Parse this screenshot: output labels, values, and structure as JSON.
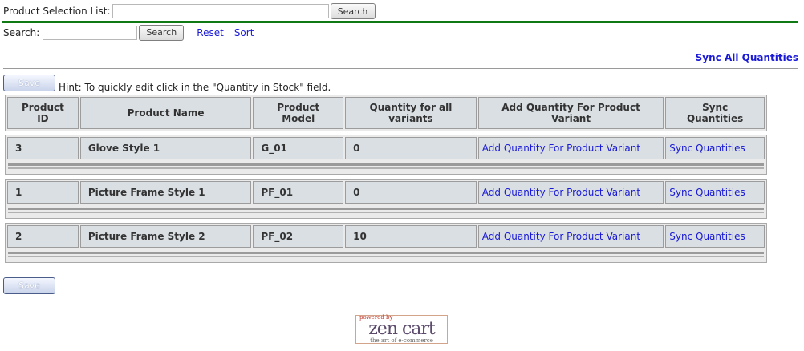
{
  "top_search": {
    "label": "Product Selection List:",
    "value": "",
    "button": "Search"
  },
  "search_bar": {
    "label": "Search:",
    "value": "",
    "button": "Search",
    "reset": "Reset",
    "sort": "Sort"
  },
  "sync_all": "Sync All Quantities",
  "save_label": "Save",
  "hint": "Hint: To quickly edit click in the \"Quantity in Stock\" field.",
  "table": {
    "headers": [
      "Product ID",
      "Product Name",
      "Product Model",
      "Quantity for all variants",
      "Add Quantity For Product Variant",
      "Sync Quantities"
    ],
    "rows": [
      {
        "id": "3",
        "name": "Glove Style 1",
        "model": "G_01",
        "qty": "0",
        "add": "Add Quantity For Product Variant",
        "sync": "Sync Quantities"
      },
      {
        "id": "1",
        "name": "Picture Frame Style 1",
        "model": "PF_01",
        "qty": "0",
        "add": "Add Quantity For Product Variant",
        "sync": "Sync Quantities"
      },
      {
        "id": "2",
        "name": "Picture Frame Style 2",
        "model": "PF_02",
        "qty": "10",
        "add": "Add Quantity For Product Variant",
        "sync": "Sync Quantities"
      }
    ]
  },
  "logo": {
    "powered": "powered by",
    "brand": "zen cart",
    "tagline": "the art of e-commerce"
  },
  "colors": {
    "green_bar": "#0f7a13",
    "link": "#1a1ad6",
    "cell_bg": "#d9dfe3"
  }
}
